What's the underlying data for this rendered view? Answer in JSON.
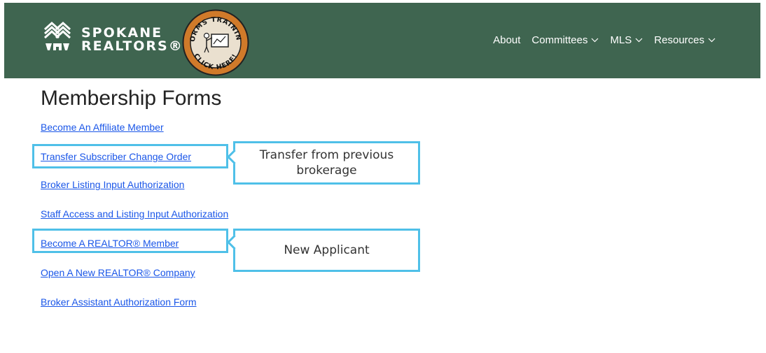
{
  "header": {
    "logo": {
      "line1": "SPOKANE",
      "line2": "REALTORS®"
    },
    "badge": {
      "top_text": "FORMS TRAINING",
      "bottom_text": "CLICK HERE!"
    },
    "nav": [
      {
        "label": "About",
        "has_dropdown": false
      },
      {
        "label": "Committees",
        "has_dropdown": true
      },
      {
        "label": "MLS",
        "has_dropdown": true
      },
      {
        "label": "Resources",
        "has_dropdown": true
      }
    ]
  },
  "page_title": "Membership Forms",
  "links": [
    {
      "label": "Become An Affiliate Member"
    },
    {
      "label": "Transfer Subscriber Change Order"
    },
    {
      "label": "Broker Listing Input Authorization"
    },
    {
      "label": "Staff Access and Listing Input Authorization"
    },
    {
      "label": "Become A REALTOR® Member"
    },
    {
      "label": "Open A New REALTOR® Company"
    },
    {
      "label": "Broker Assistant Authorization Form"
    }
  ],
  "callouts": [
    {
      "text": "Transfer from previous brokerage"
    },
    {
      "text": "New Applicant"
    }
  ],
  "colors": {
    "header_bg": "#3f6550",
    "link": "#1a56e8",
    "callout_border": "#4fc0e8"
  }
}
